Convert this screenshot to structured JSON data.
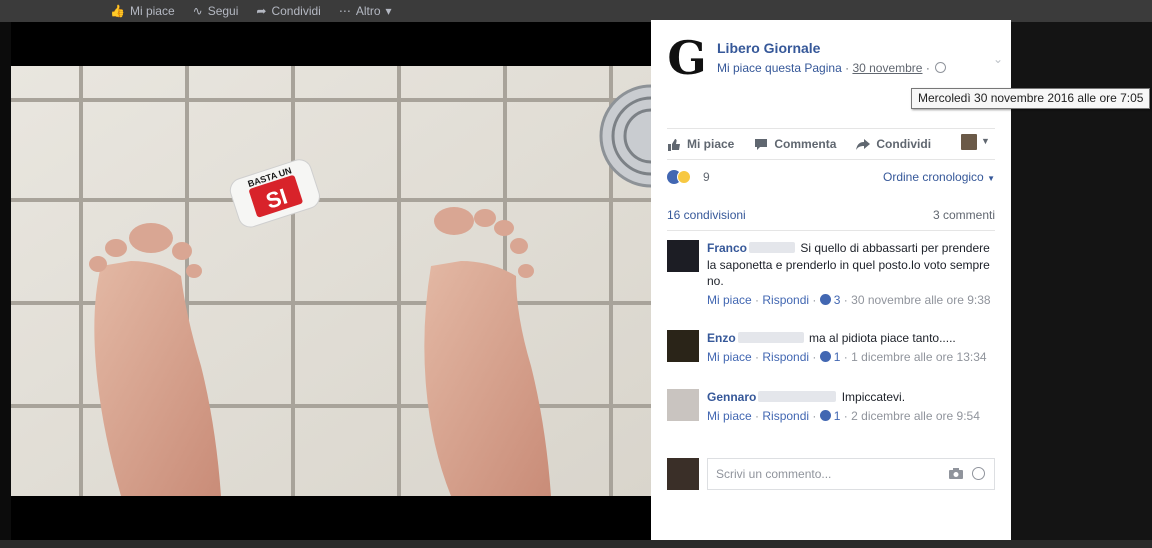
{
  "toolbar": {
    "like": "Mi piace",
    "follow": "Segui",
    "share": "Condividi",
    "more": "Altro"
  },
  "post": {
    "page_name": "Libero Giornale",
    "logo_letter": "G",
    "meta_like": "Mi piace questa Pagina",
    "meta_sep": "·",
    "date": "30 novembre",
    "tooltip": "Mercoledì 30 novembre 2016 alle ore 7:05",
    "image_text": {
      "top": "BASTA UN",
      "main": "SI"
    }
  },
  "actions": {
    "like": "Mi piace",
    "comment": "Commenta",
    "share": "Condividi"
  },
  "reactions": {
    "count": "9",
    "order": "Ordine cronologico"
  },
  "stats": {
    "shares": "16 condivisioni",
    "comments": "3 commenti"
  },
  "comments": [
    {
      "author": "Franco",
      "text": "Si quello di abbassarti per prendere la saponetta e prenderlo in quel posto.lo voto sempre no.",
      "like": "Mi piace",
      "reply": "Rispondi",
      "likes": "3",
      "time": "30 novembre alle ore 9:38"
    },
    {
      "author": "Enzo",
      "text": "ma al pidiota piace tanto.....",
      "like": "Mi piace",
      "reply": "Rispondi",
      "likes": "1",
      "time": "1 dicembre alle ore 13:34"
    },
    {
      "author": "Gennaro",
      "text": "Impiccatevi.",
      "like": "Mi piace",
      "reply": "Rispondi",
      "likes": "1",
      "time": "2 dicembre alle ore 9:54"
    }
  ],
  "compose": {
    "placeholder": "Scrivi un commento..."
  },
  "colors": {
    "fb_blue": "#365899",
    "reaction_blue": "#4267b2",
    "soap_red": "#d8232a"
  }
}
